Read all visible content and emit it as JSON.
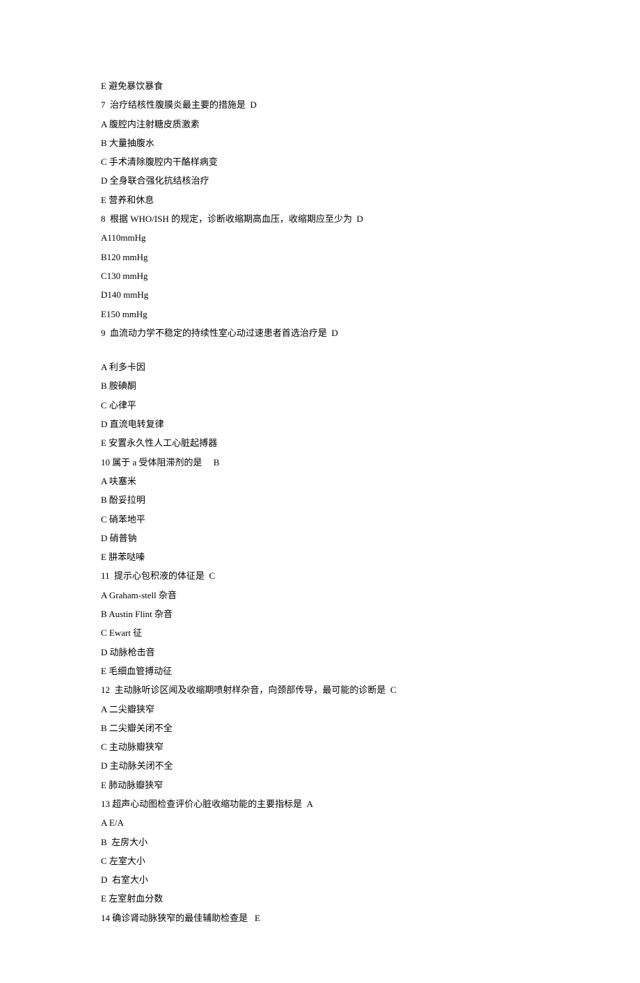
{
  "lines": [
    "E 避免暴饮暴食",
    "7  治疗结核性腹膜炎最主要的措施是  D",
    "A 腹腔内注射糖皮质激素",
    "B 大量抽腹水",
    "C 手术清除腹腔内干酪样病变",
    "D 全身联合强化抗结核治疗",
    "E 营养和休息",
    "8  根据 WHO/ISH 的规定，诊断收缩期高血压，收缩期应至少为  D",
    "A110mmHg",
    "B120 mmHg",
    "C130 mmHg",
    "D140 mmHg",
    "E150 mmHg",
    "9  血流动力学不稳定的持续性室心动过速患者首选治疗是  D",
    "__GAP__",
    "A 利多卡因",
    "B 胺碘酮",
    "C 心律平",
    "D 直流电转复律",
    "E 安置永久性人工心脏起搏器",
    "10 属于 a 受体阻滞剂的是     B",
    "A 呋塞米",
    "B 酚妥拉明",
    "C 硝苯地平",
    "D 硝普钠",
    "E 肼苯哒嗪",
    "11  提示心包积液的体征是  C",
    "A Graham-stell 杂音",
    "B Austin Flint 杂音",
    "C Ewart 征",
    "D 动脉枪击音",
    "E 毛细血管搏动征",
    "12  主动脉听诊区闻及收缩期喷射样杂音，向颈部传导，最可能的诊断是  C",
    "A 二尖瓣狭窄",
    "B 二尖瓣关闭不全",
    "C 主动脉瓣狭窄",
    "D 主动脉关闭不全",
    "E 肺动脉瓣狭窄",
    "13 超声心动图检查评价心脏收缩功能的主要指标是  A",
    "A E/A",
    "B  左房大小",
    "C 左室大小",
    "D  右室大小",
    "E 左室射血分数",
    "14 确诊肾动脉狭窄的最佳辅助检查是   E"
  ]
}
